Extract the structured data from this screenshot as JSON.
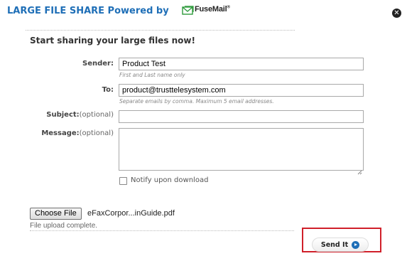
{
  "header": {
    "title": "LARGE FILE SHARE Powered by",
    "logo_text": "FuseMail",
    "logo_mark": "®",
    "close_icon": "close-icon"
  },
  "form": {
    "heading": "Start sharing your large files now!",
    "sender_label": "Sender:",
    "sender_value": "Product Test",
    "sender_hint": "First and Last name only",
    "to_label": "To:",
    "to_value": "product@trusttelesystem.com",
    "to_hint": "Separate emails by comma. Maximum 5 email addresses.",
    "subject_label": "Subject:",
    "subject_optional": "(optional)",
    "subject_value": "",
    "message_label": "Message:",
    "message_optional": "(optional)",
    "message_value": "",
    "notify_label": "Notify upon download",
    "notify_checked": false
  },
  "upload": {
    "choose_label": "Choose File",
    "file_name": "eFaxCorpor...inGuide.pdf",
    "status": "File upload complete."
  },
  "actions": {
    "send_label": "Send It"
  },
  "colors": {
    "title": "#1f6fb7",
    "highlight": "#d0202a",
    "logo_green": "#2e9a3c"
  }
}
